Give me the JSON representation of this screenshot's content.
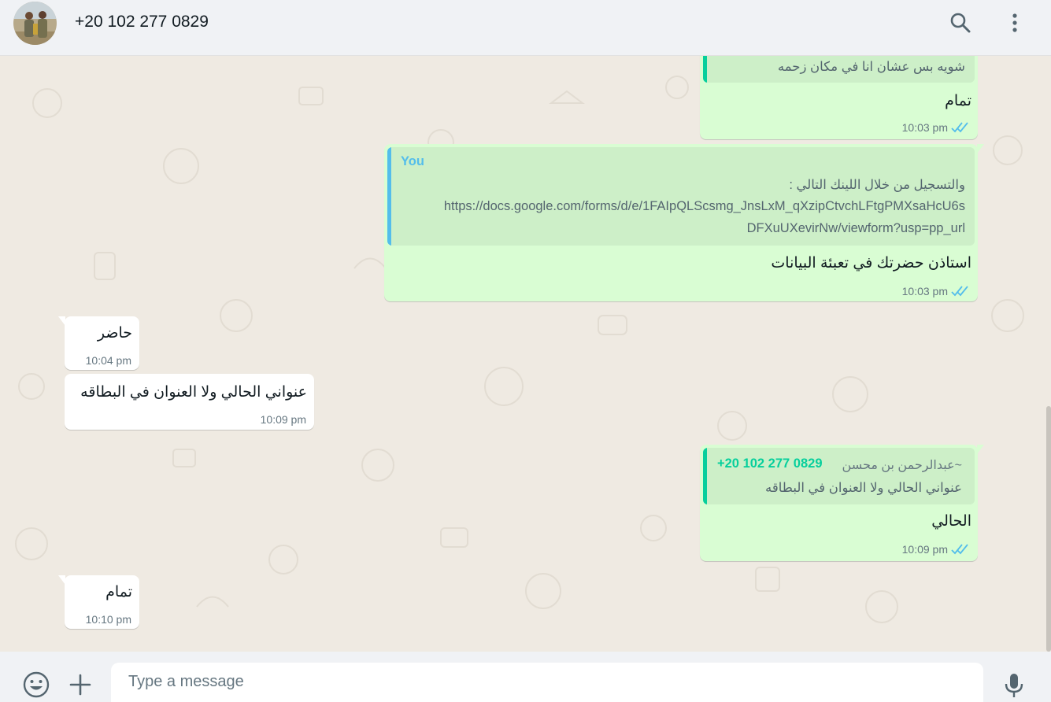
{
  "header": {
    "contact_name": "+20 102 277 0829",
    "avatar_icon": "contact-avatar",
    "search_icon": "search-icon",
    "menu_icon": "menu-icon"
  },
  "messages": [
    {
      "direction": "outgoing",
      "quote_text": "شويه بس عشان انا في مكان زحمه",
      "text": "تمام",
      "time": "10:03 pm",
      "status": "read"
    },
    {
      "direction": "outgoing",
      "quote_author": "You",
      "quote_line1": "والتسجيل من خلال اللينك التالي :",
      "quote_line2": "https://docs.google.com/forms/d/e/1FAIpQLScsmg_JnsLxM_qXzipCtvchLFtgPMXsaHcU6s",
      "quote_line3": "DFXuUXevirNw/viewform?usp=pp_url",
      "text": "استاذن حضرتك في تعبئة البيانات",
      "time": "10:03 pm",
      "status": "read"
    },
    {
      "direction": "incoming",
      "text": "حاضر",
      "time": "10:04 pm"
    },
    {
      "direction": "incoming",
      "text": "عنواني الحالي ولا العنوان في البطاقه",
      "time": "10:09 pm"
    },
    {
      "direction": "outgoing",
      "quote_author": "+20 102 277 0829",
      "quote_pushname": "~عبدالرحمن بن محسن",
      "quote_text": "عنواني الحالي ولا العنوان في البطاقه",
      "text": "الحالي",
      "time": "10:09 pm",
      "status": "read"
    },
    {
      "direction": "incoming",
      "text": "تمام",
      "time": "10:10 pm"
    }
  ],
  "footer": {
    "placeholder": "Type a message",
    "emoji_icon": "emoji-icon",
    "attach_icon": "plus-icon",
    "mic_icon": "microphone-icon"
  },
  "colors": {
    "outgoing_bubble": "#d9fdd3",
    "incoming_bubble": "#ffffff",
    "chat_background": "#efeae2",
    "read_ticks": "#53bdeb",
    "quote_you": "#53bdeb",
    "quote_contact": "#06cf9c"
  }
}
